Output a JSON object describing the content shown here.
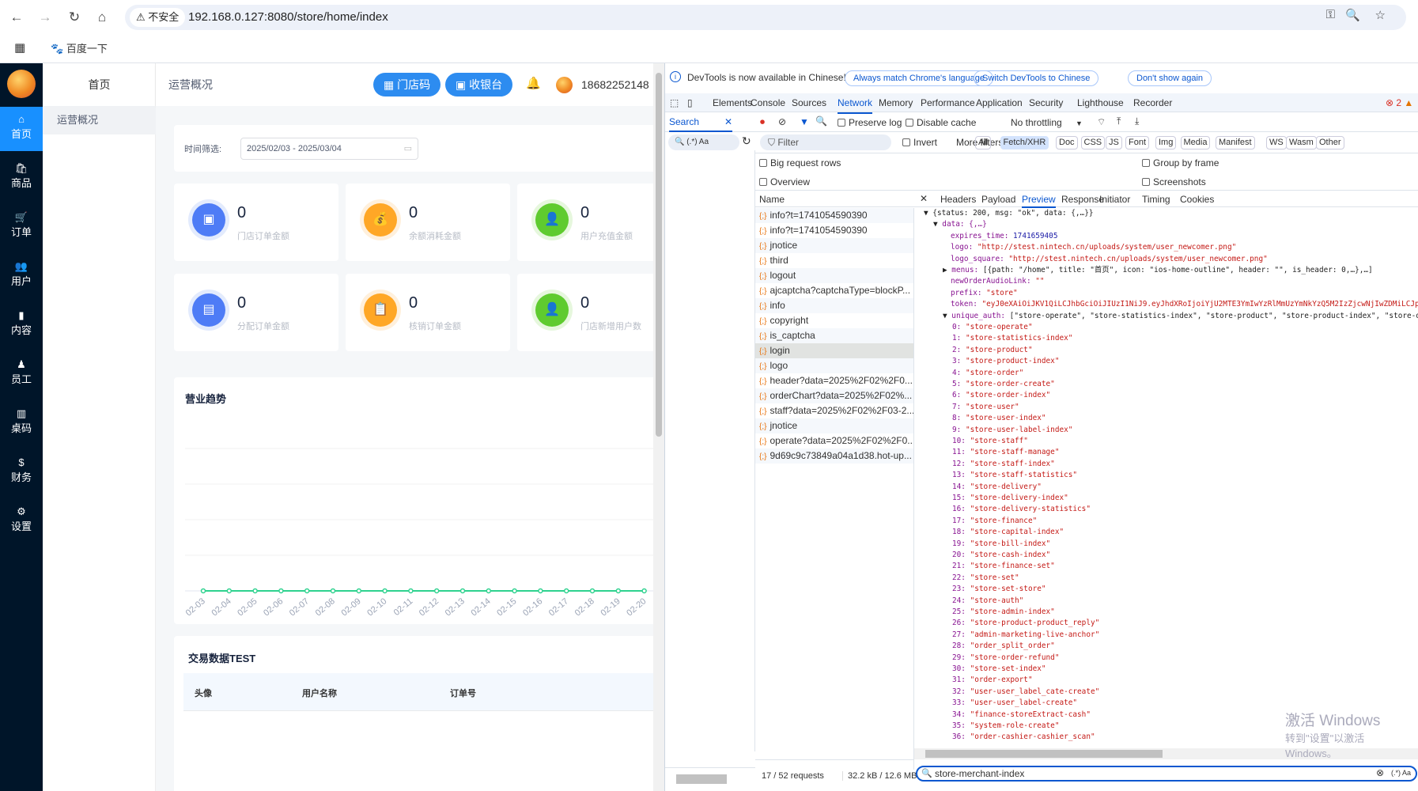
{
  "browser": {
    "url": "192.168.0.127:8080/store/home/index",
    "security": "不安全",
    "bookmark": "百度一下"
  },
  "sidebar": {
    "items": [
      {
        "label": "首页",
        "icon": "⌂"
      },
      {
        "label": "商品",
        "icon": "🛍"
      },
      {
        "label": "订单",
        "icon": "🛒"
      },
      {
        "label": "用户",
        "icon": "👥"
      },
      {
        "label": "内容",
        "icon": "▮"
      },
      {
        "label": "员工",
        "icon": "♟"
      },
      {
        "label": "桌码",
        "icon": "▥"
      },
      {
        "label": "财务",
        "icon": "$"
      },
      {
        "label": "设置",
        "icon": "⚙"
      }
    ]
  },
  "subnav": {
    "title": "首页",
    "item": "运营概况"
  },
  "header": {
    "breadcrumb": "运营概况",
    "store_code": "门店码",
    "cashier": "收银台",
    "user": "18682252148"
  },
  "filter": {
    "label": "时间筛选:",
    "value": "2025/02/03 - 2025/03/04"
  },
  "stats": [
    {
      "value": "0",
      "label": "门店订单金额",
      "color": "#4e7cf6",
      "ring": "#e3ebfd",
      "icon": "▣"
    },
    {
      "value": "0",
      "label": "余额消耗金额",
      "color": "#ffa726",
      "ring": "#fff0dc",
      "icon": "💰"
    },
    {
      "value": "0",
      "label": "用户充值金额",
      "color": "#5fcb2f",
      "ring": "#e6f7dd",
      "icon": "👤"
    },
    {
      "value": "0",
      "label": "分配订单金额",
      "color": "#4e7cf6",
      "ring": "#e3ebfd",
      "icon": "▤"
    },
    {
      "value": "0",
      "label": "核销订单金额",
      "color": "#ffa726",
      "ring": "#fff0dc",
      "icon": "📋"
    },
    {
      "value": "0",
      "label": "门店新增用户数",
      "color": "#5fcb2f",
      "ring": "#e6f7dd",
      "icon": "👤"
    }
  ],
  "chart_data": {
    "type": "line",
    "title": "营业趋势",
    "categories": [
      "02-03",
      "02-04",
      "02-05",
      "02-06",
      "02-07",
      "02-08",
      "02-09",
      "02-10",
      "02-11",
      "02-12",
      "02-13",
      "02-14",
      "02-15",
      "02-16",
      "02-17",
      "02-18",
      "02-19",
      "02-20"
    ],
    "values": [
      0,
      0,
      0,
      0,
      0,
      0,
      0,
      0,
      0,
      0,
      0,
      0,
      0,
      0,
      0,
      0,
      0,
      0
    ],
    "color": "#2fd28f",
    "grid": true
  },
  "table": {
    "title": "交易数据TEST",
    "columns": [
      "头像",
      "用户名称",
      "订单号"
    ]
  },
  "devtools": {
    "banner": {
      "text": "DevTools is now available in Chinese!",
      "b1": "Always match Chrome's language",
      "b2": "Switch DevTools to Chinese",
      "b3": "Don't show again"
    },
    "tabs": [
      "Elements",
      "Console",
      "Sources",
      "Network",
      "Memory",
      "Performance",
      "Application",
      "Security",
      "Lighthouse",
      "Recorder"
    ],
    "active_tab": "Network",
    "errors": "2",
    "search_tab": "Search",
    "preserve_log": "Preserve log",
    "disable_cache": "Disable cache",
    "throttling": "No throttling",
    "filter_placeholder": "Filter",
    "invert": "Invert",
    "more_filters": "More filters",
    "types": [
      "All",
      "Fetch/XHR",
      "Doc",
      "CSS",
      "JS",
      "Font",
      "Img",
      "Media",
      "Manifest",
      "WS",
      "Wasm",
      "Other"
    ],
    "opts": {
      "big": "Big request rows",
      "overview": "Overview",
      "group": "Group by frame",
      "shots": "Screenshots"
    },
    "name_header": "Name",
    "detail_tabs": [
      "Headers",
      "Payload",
      "Preview",
      "Response",
      "Initiator",
      "Timing",
      "Cookies"
    ],
    "requests": [
      "info?t=1741054590390",
      "info?t=1741054590390",
      "jnotice",
      "third",
      "logout",
      "ajcaptcha?captchaType=blockP...",
      "info",
      "copyright",
      "is_captcha",
      "login",
      "logo",
      "header?data=2025%2F02%2F0...",
      "orderChart?data=2025%2F02%...",
      "staff?data=2025%2F02%2F03-2...",
      "jnotice",
      "operate?data=2025%2F02%2F0...",
      "9d69c9c73849a04a1d38.hot-up..."
    ],
    "selected": "login",
    "preview": [
      {
        "t": "{status: 200, msg: \"ok\", data: {,…}}",
        "c": "p",
        "i": 0,
        "a": "▼"
      },
      {
        "t": "data: {,…}",
        "c": "k",
        "i": 1,
        "a": "▼"
      },
      {
        "k": "expires_time: ",
        "t": "1741659405",
        "c": "n",
        "i": 2
      },
      {
        "k": "logo: ",
        "t": "\"http://stest.nintech.cn/uploads/system/user_newcomer.png\"",
        "c": "s",
        "i": 2
      },
      {
        "k": "logo_square: ",
        "t": "\"http://stest.nintech.cn/uploads/system/user_newcomer.png\"",
        "c": "s",
        "i": 2
      },
      {
        "k": "menus: ",
        "t": "[{path: \"/home\", title: \"首页\", icon: \"ios-home-outline\", header: \"\", is_header: 0,…},…]",
        "c": "p",
        "i": 2,
        "a": "▶"
      },
      {
        "k": "newOrderAudioLink: ",
        "t": "\"\"",
        "c": "s",
        "i": 2
      },
      {
        "k": "prefix: ",
        "t": "\"store\"",
        "c": "s",
        "i": 2
      },
      {
        "k": "token: ",
        "t": "\"eyJ0eXAiOiJKV1QiLCJhbGciOiJIUzI1NiJ9.eyJhdXRoIjoiYjU2MTE3YmIwYzRlMmUzYmNkYzQ5M2IzZjcwNjIwZDMiLCJpc3MiOi",
        "c": "s",
        "i": 2
      },
      {
        "k": "unique_auth: ",
        "t": "[\"store-operate\", \"store-statistics-index\", \"store-product\", \"store-product-index\", \"store-order\",",
        "c": "p",
        "i": 2,
        "a": "▼"
      }
    ],
    "unique_auth": [
      "store-operate",
      "store-statistics-index",
      "store-product",
      "store-product-index",
      "store-order",
      "store-order-create",
      "store-order-index",
      "store-user",
      "store-user-index",
      "store-user-label-index",
      "store-staff",
      "store-staff-manage",
      "store-staff-index",
      "store-staff-statistics",
      "store-delivery",
      "store-delivery-index",
      "store-delivery-statistics",
      "store-finance",
      "store-capital-index",
      "store-bill-index",
      "store-cash-index",
      "store-finance-set",
      "store-set",
      "store-set-store",
      "store-auth",
      "store-admin-index",
      "store-product-product_reply",
      "admin-marketing-live-anchor",
      "order_split_order",
      "store-order-refund",
      "store-set-index",
      "order-export",
      "user-user_label_cate-create",
      "user-user_label-create",
      "finance-storeExtract-cash",
      "system-role-create",
      "order-cashier-cashier_scan"
    ],
    "status": {
      "requests": "17 / 52 requests",
      "size": "32.2 kB / 12.6 MB"
    },
    "search_value": "store-merchant-index"
  },
  "watermark": {
    "line1": "激活 Windows",
    "line2": "转到\"设置\"以激活 Windows。"
  }
}
